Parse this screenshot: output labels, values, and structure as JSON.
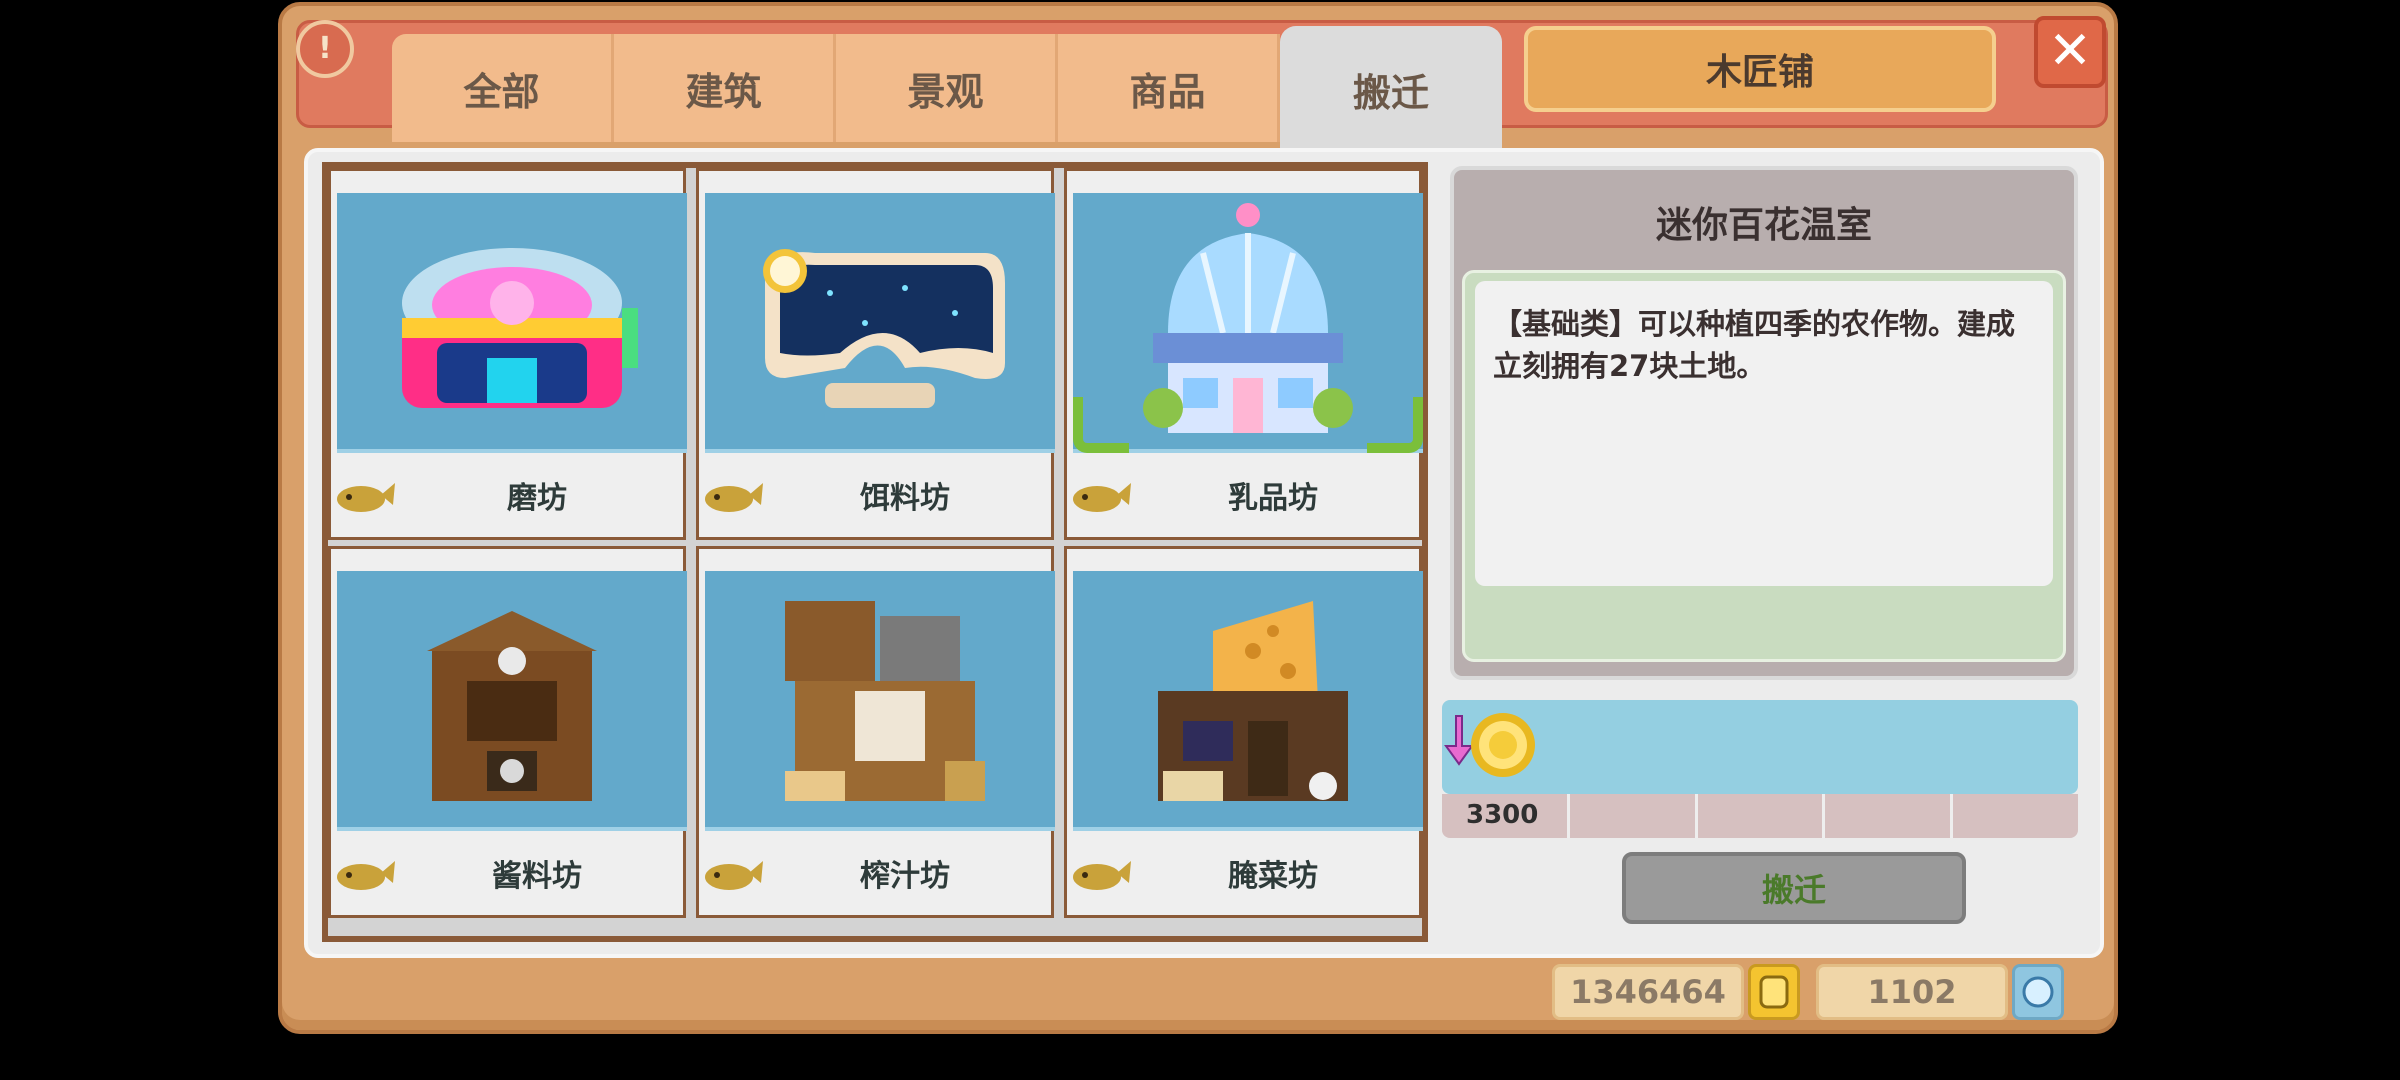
{
  "tabs": [
    {
      "label": "全部"
    },
    {
      "label": "建筑"
    },
    {
      "label": "景观"
    },
    {
      "label": "商品"
    },
    {
      "label": "搬迁",
      "active": true
    }
  ],
  "shop_title": "木匠铺",
  "close_label": "✕",
  "alert_label": "!",
  "items": [
    {
      "name": "磨坊",
      "icon": "pig-dome-building-icon"
    },
    {
      "name": "饵料坊",
      "icon": "night-pool-alarm-clock-icon"
    },
    {
      "name": "乳品坊",
      "icon": "greenhouse-dome-icon",
      "selected": true
    },
    {
      "name": "酱料坊",
      "icon": "sauce-workshop-icon"
    },
    {
      "name": "榨汁坊",
      "icon": "juice-workshop-icon"
    },
    {
      "name": "腌菜坊",
      "icon": "pickle-workshop-icon"
    }
  ],
  "detail": {
    "title": "迷你百花温室",
    "description": "【基础类】可以种植四季的农作物。建成立刻拥有27块土地。",
    "cost": "3300",
    "button_label": "搬迁"
  },
  "resources": {
    "gold": "1346464",
    "gems": "1102"
  },
  "colors": {
    "panel": "#d9a06a",
    "tile_bg": "#63a9cb",
    "selected": "#7bbf3a",
    "header": "#e07a5f"
  }
}
